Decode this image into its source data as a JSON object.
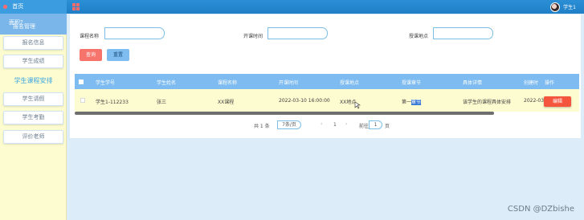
{
  "app": {
    "home_label": "首页",
    "menu_title": "报名管理",
    "menu_overlay": "面积?",
    "user_name": "学生1"
  },
  "sidebar": {
    "items": [
      {
        "label": "报名信息",
        "active": false
      },
      {
        "label": "学生成绩",
        "active": false
      },
      {
        "label": "学生课程安排",
        "active": true
      },
      {
        "label": "学生请假",
        "active": false
      },
      {
        "label": "学生考勤",
        "active": false
      },
      {
        "label": "评价老师",
        "active": false
      }
    ]
  },
  "filters": {
    "course_name_label": "课程名称",
    "start_time_label": "开课时间",
    "location_label": "授课地点",
    "search_button": "查询",
    "reset_button": "重置"
  },
  "table": {
    "headers": [
      "学生学号",
      "学生姓名",
      "课程名称",
      "开课时间",
      "授课地点",
      "授课章节",
      "具体详情",
      "创建时",
      "操作"
    ],
    "rows": [
      {
        "student_id": "学生1-112233",
        "student_name": "张三",
        "course_name": "XX课程",
        "start_time": "2022-03-10 16:00:00",
        "location": "XX地点",
        "chapter_prefix": "第一",
        "chapter_highlight": "章节",
        "detail": "该学生的课程具体安排",
        "created": "2022-03-",
        "action": "编辑"
      }
    ]
  },
  "pagination": {
    "total": "共 1 条",
    "page_size": "7条/页",
    "prev": "‹",
    "page": "1",
    "next": "›",
    "goto_label": "前往",
    "goto_value": "1",
    "page_unit": "页"
  },
  "watermark": "CSDN @DZbishe",
  "colors": {
    "topbar": "#2b8fd6",
    "sidebar_bg": "#fdfbd0",
    "table_header": "#7dbbf0",
    "edit_button": "#f5543d",
    "search_button": "#f7746d",
    "reset_button": "#7fbdf0"
  }
}
